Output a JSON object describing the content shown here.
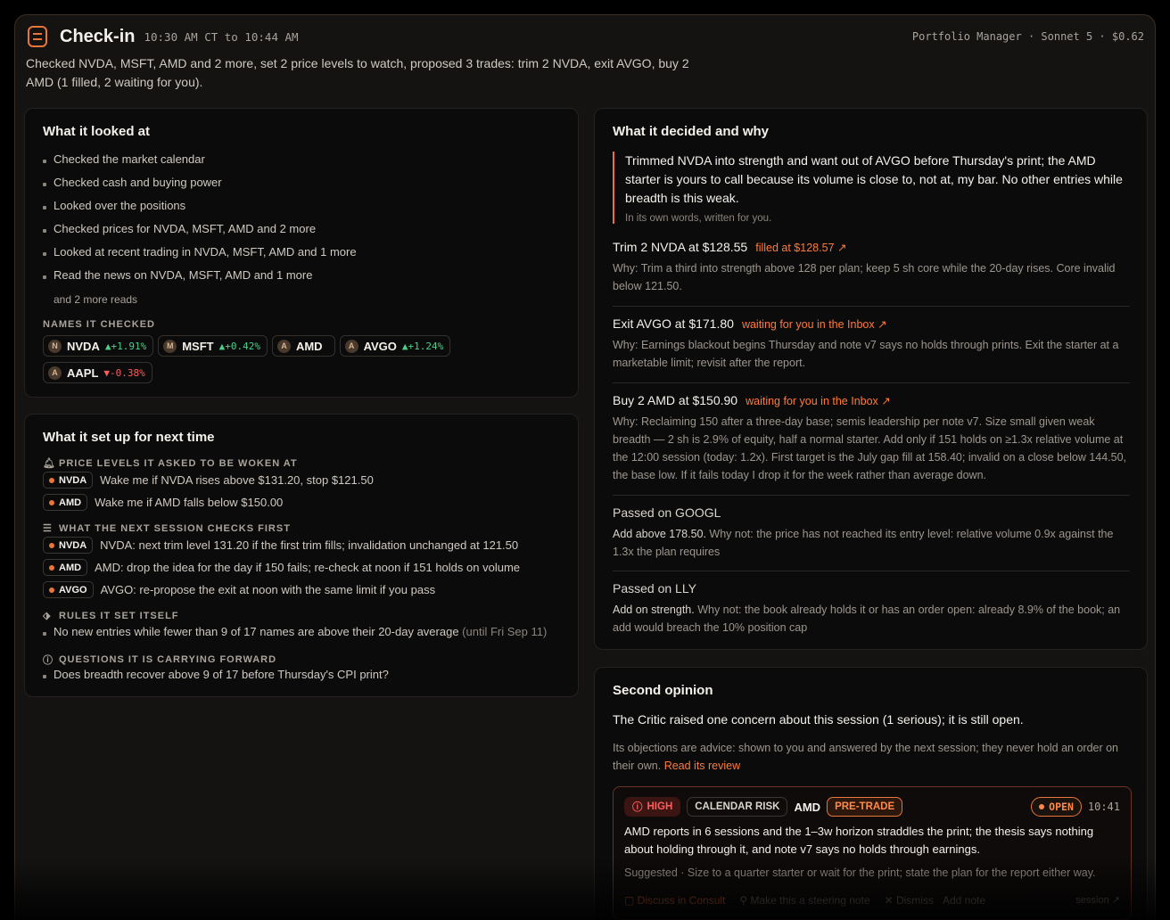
{
  "header": {
    "title": "Check-in",
    "time_range": "10:30 AM CT to 10:44 AM",
    "meta": "Portfolio Manager · Sonnet 5 · $0.62"
  },
  "summary": "Checked NVDA, MSFT, AMD and 2 more, set 2 price levels to watch, proposed 3 trades: trim 2 NVDA, exit AVGO, buy 2 AMD (1 filled, 2 waiting for you).",
  "looked_at": {
    "title": "What it looked at",
    "items": [
      "Checked the market calendar",
      "Checked cash and buying power",
      "Looked over the positions",
      "Checked prices for NVDA, MSFT, AMD and 2 more",
      "Looked at recent trading in NVDA, MSFT, AMD and 1 more",
      "Read the news on NVDA, MSFT, AMD and 1 more"
    ],
    "more": "and 2 more reads",
    "names_label": "NAMES IT CHECKED",
    "names": [
      {
        "initial": "N",
        "symbol": "NVDA",
        "change": "▲+1.91%",
        "dir": "up"
      },
      {
        "initial": "M",
        "symbol": "MSFT",
        "change": "▲+0.42%",
        "dir": "up"
      },
      {
        "initial": "A",
        "symbol": "AMD",
        "change": "",
        "dir": ""
      },
      {
        "initial": "A",
        "symbol": "AVGO",
        "change": "▲+1.24%",
        "dir": "up"
      },
      {
        "initial": "A",
        "symbol": "AAPL",
        "change": "▼-0.38%",
        "dir": "dn"
      }
    ]
  },
  "setup": {
    "title": "What it set up for next time",
    "levels_label": "PRICE LEVELS IT ASKED TO BE WOKEN AT",
    "levels": [
      {
        "tag": "NVDA",
        "text": "Wake me if NVDA rises above $131.20, stop $121.50"
      },
      {
        "tag": "AMD",
        "text": "Wake me if AMD falls below $150.00"
      }
    ],
    "checks_label": "WHAT THE NEXT SESSION CHECKS FIRST",
    "checks": [
      {
        "tag": "NVDA",
        "text": "NVDA: next trim level 131.20 if the first trim fills; invalidation unchanged at 121.50"
      },
      {
        "tag": "AMD",
        "text": "AMD: drop the idea for the day if 150 fails; re-check at noon if 151 holds on volume"
      },
      {
        "tag": "AVGO",
        "text": "AVGO: re-propose the exit at noon with the same limit if you pass"
      }
    ],
    "rules_label": "RULES IT SET ITSELF",
    "rule_text": "No new entries while fewer than 9 of 17 names are above their 20-day average",
    "rule_until": "(until Fri Sep 11)",
    "questions_label": "QUESTIONS IT IS CARRYING FORWARD",
    "question": "Does breadth recover above 9 of 17 before Thursday's CPI print?"
  },
  "decided": {
    "title": "What it decided and why",
    "quote": "Trimmed NVDA into strength and want out of AVGO before Thursday's print; the AMD starter is yours to call because its volume is close to, not at, my bar. No other entries while breadth is this weak.",
    "quote_note": "In its own words, written for you.",
    "trades": [
      {
        "head": "Trim 2 NVDA at $128.55",
        "status": "filled at $128.57 ↗",
        "why": "Why: Trim a third into strength above 128 per plan; keep 5 sh core while the 20-day rises. Core invalid below 121.50."
      },
      {
        "head": "Exit AVGO at $171.80",
        "status": "waiting for you in the Inbox ↗",
        "why": "Why: Earnings blackout begins Thursday and note v7 says no holds through prints. Exit the starter at a marketable limit; revisit after the report."
      },
      {
        "head": "Buy 2 AMD at $150.90",
        "status": "waiting for you in the Inbox ↗",
        "why": "Why: Reclaiming 150 after a three-day base; semis leadership per note v7. Size small given weak breadth — 2 sh is 2.9% of equity, half a normal starter. Add only if 151 holds on ≥1.3x relative volume at the 12:00 session (today: 1.2x). First target is the July gap fill at 158.40; invalid on a close below 144.50, the base low. If it fails today I drop it for the week rather than average down."
      }
    ],
    "passed": [
      {
        "head": "Passed on GOOGL",
        "lead": "Add above 178.50.",
        "why": " Why not: the price has not reached its entry level: relative volume 0.9x against the 1.3x the plan requires"
      },
      {
        "head": "Passed on LLY",
        "lead": "Add on strength.",
        "why": " Why not: the book already holds it or has an order open: already 8.9% of the book; an add would breach the 10% position cap"
      }
    ]
  },
  "second": {
    "title": "Second opinion",
    "line": "The Critic raised one concern about this session (1 serious); it is still open.",
    "note": "Its objections are advice: shown to you and answered by the next session; they never hold an order on their own.",
    "review_link": "Read its review",
    "critic": {
      "severity": "HIGH",
      "category": "CALENDAR RISK",
      "symbol": "AMD",
      "phase": "PRE-TRADE",
      "state": "OPEN",
      "time": "10:41",
      "body": "AMD reports in 6 sessions and the 1–3w horizon straddles the print; the thesis says nothing about holding through it, and note v7 says no holds through earnings.",
      "suggested": "Suggested · Size to a quarter starter or wait for the print; state the plan for the report either way.",
      "actions": [
        "Discuss in Consult",
        "Make this a steering note",
        "Dismiss",
        "Add note"
      ],
      "session_link": "session ↗"
    }
  }
}
